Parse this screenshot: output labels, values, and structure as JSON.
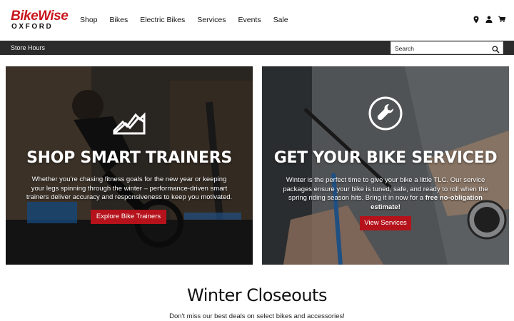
{
  "header": {
    "logo_main": "BikeWise",
    "logo_sub": "OXFORD",
    "nav": [
      "Shop",
      "Bikes",
      "Electric Bikes",
      "Services",
      "Events",
      "Sale"
    ],
    "icons": [
      "location-pin-icon",
      "account-icon",
      "cart-icon"
    ]
  },
  "bar": {
    "store_hours": "Store Hours",
    "search_placeholder": "Search"
  },
  "promos": [
    {
      "title": "SHOP SMART TRAINERS",
      "text": "Whether you're chasing fitness goals for the new year or keeping your legs spinning through the winter – performance-driven smart trainers deliver accuracy and responsiveness to keep you motivated.",
      "button": "Explore Bike Trainers",
      "icon": "mountain-graph-icon"
    },
    {
      "title": "GET YOUR BIKE SERVICED",
      "text_plain": "Winter is the perfect time to give your bike a little TLC. Our service packages ensure your bike is tuned, safe, and ready to roll when the spring riding season hits. Bring it in now for a ",
      "text_bold": "free no-obligation estimate!",
      "button": "View Services",
      "icon": "wrench-icon"
    }
  ],
  "section": {
    "title": "Winter Closeouts",
    "subtitle": "Don't miss our best deals on select bikes and accessories!"
  },
  "colors": {
    "brand_red": "#c8161d",
    "button_red": "#b5121b",
    "bar_dark": "#2b2b2b"
  }
}
